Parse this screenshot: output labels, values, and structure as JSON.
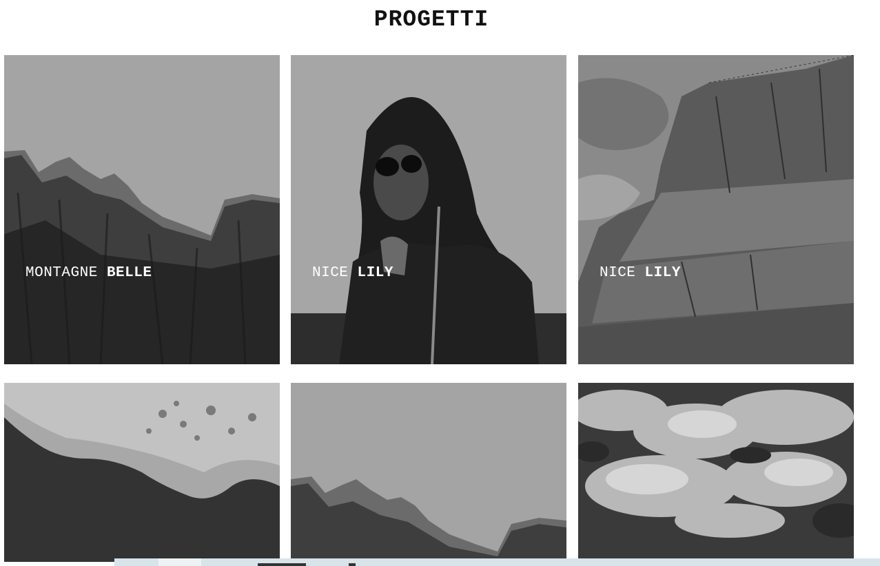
{
  "page": {
    "title": "PROGETTI"
  },
  "projects": [
    {
      "name_light": "MONTAGNE",
      "name_bold": "BELLE",
      "image": "mountain-peaks"
    },
    {
      "name_light": "NICE",
      "name_bold": "LILY",
      "image": "woman-sunglasses"
    },
    {
      "name_light": "NICE",
      "name_bold": "LILY",
      "image": "marble-quarry"
    },
    {
      "name_light": "",
      "name_bold": "",
      "image": "sea-foam-beach"
    },
    {
      "name_light": "",
      "name_bold": "",
      "image": "mountain-peaks"
    },
    {
      "name_light": "",
      "name_bold": "",
      "image": "cloudy-sky"
    }
  ]
}
